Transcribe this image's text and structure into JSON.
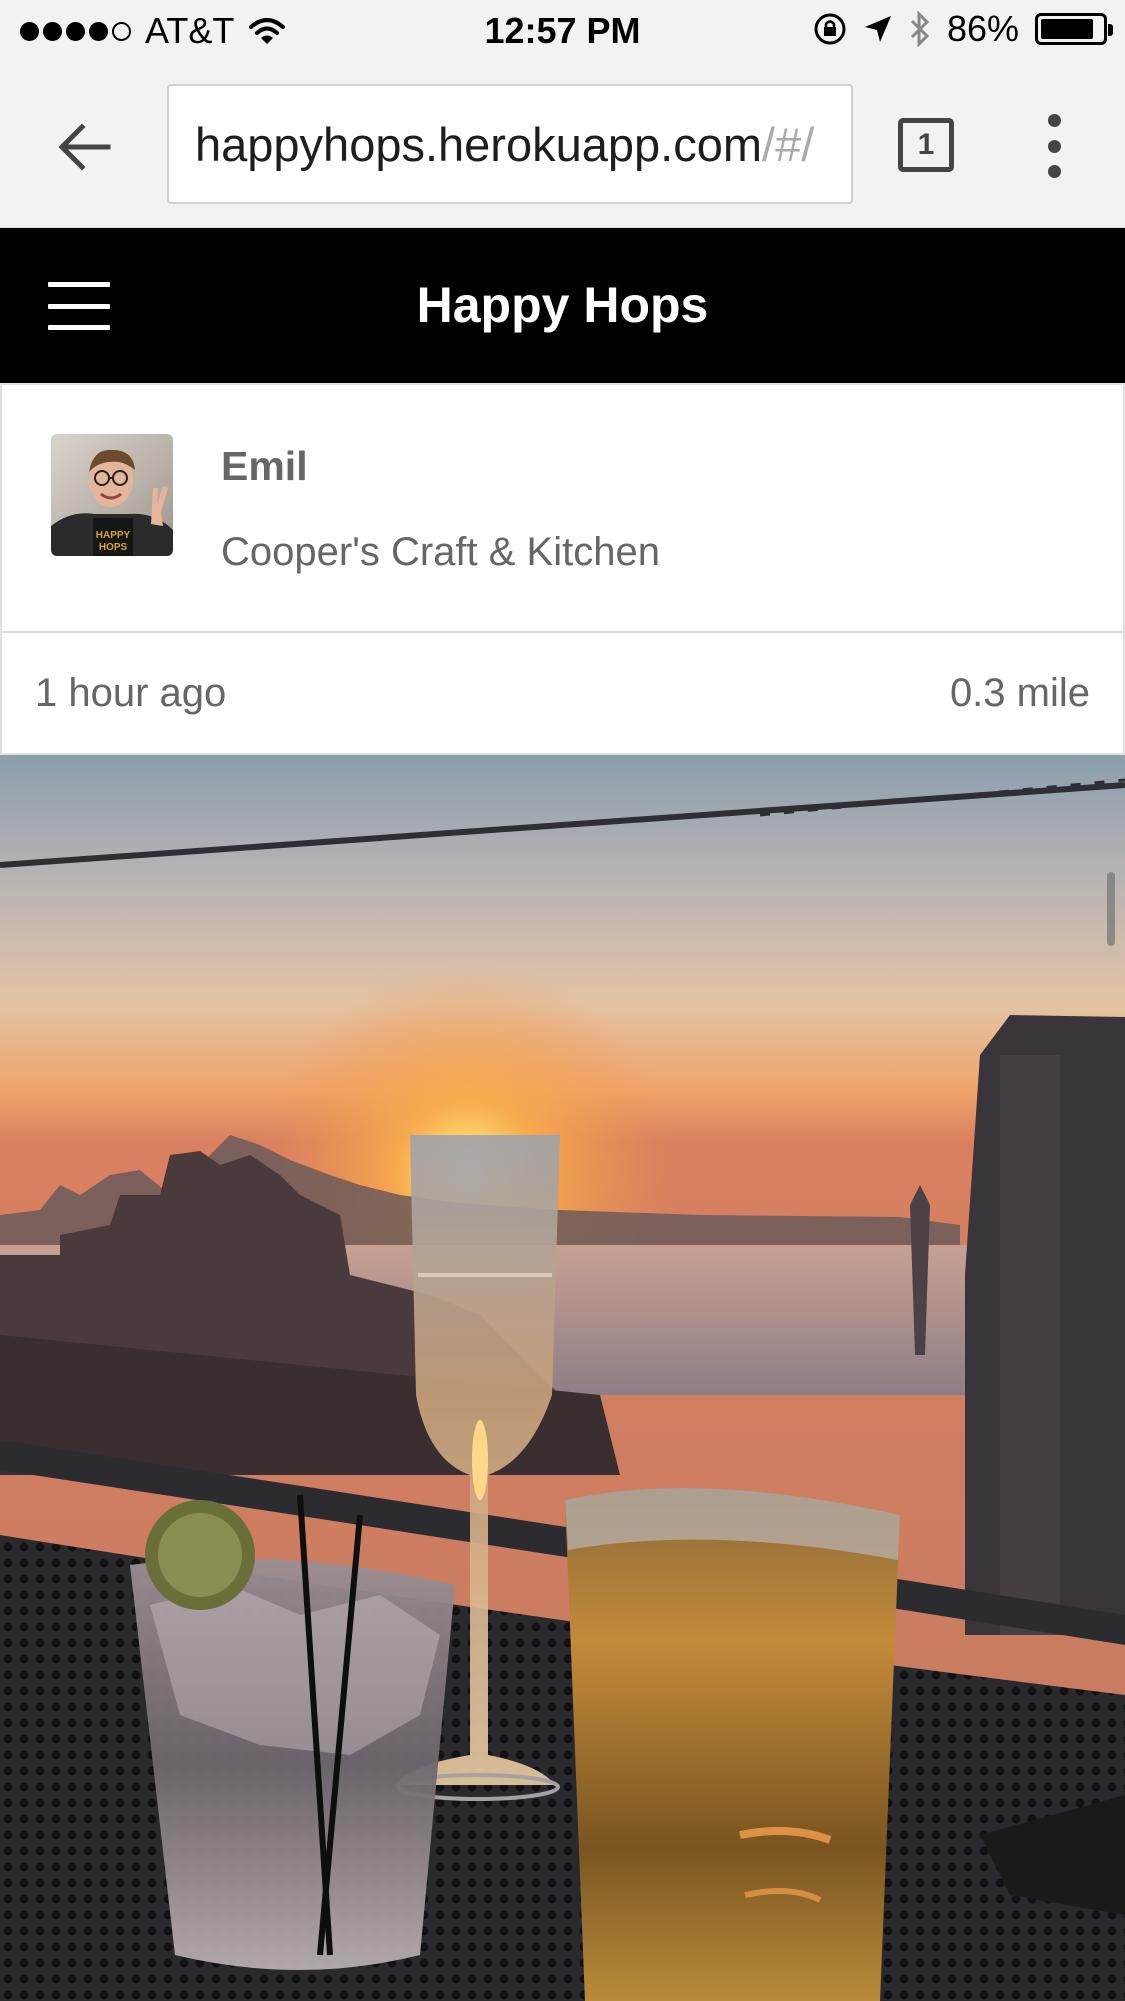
{
  "status_bar": {
    "carrier": "AT&T",
    "time": "12:57 PM",
    "battery_percent": "86%",
    "battery_level": 0.86,
    "signal_bars": 4,
    "signal_max": 5
  },
  "browser": {
    "url_host": "happyhops.herokuapp.com",
    "url_path": "/#/",
    "tab_count": "1"
  },
  "app": {
    "title": "Happy Hops"
  },
  "post": {
    "user_name": "Emil",
    "venue": "Cooper's Craft & Kitchen",
    "time_ago": "1 hour ago",
    "distance": "0.3 mile"
  },
  "colors": {
    "header_bg": "#000000",
    "text_gray": "#666666",
    "sky_top": "#8fa3b0",
    "sunset": "#f2a25a"
  }
}
